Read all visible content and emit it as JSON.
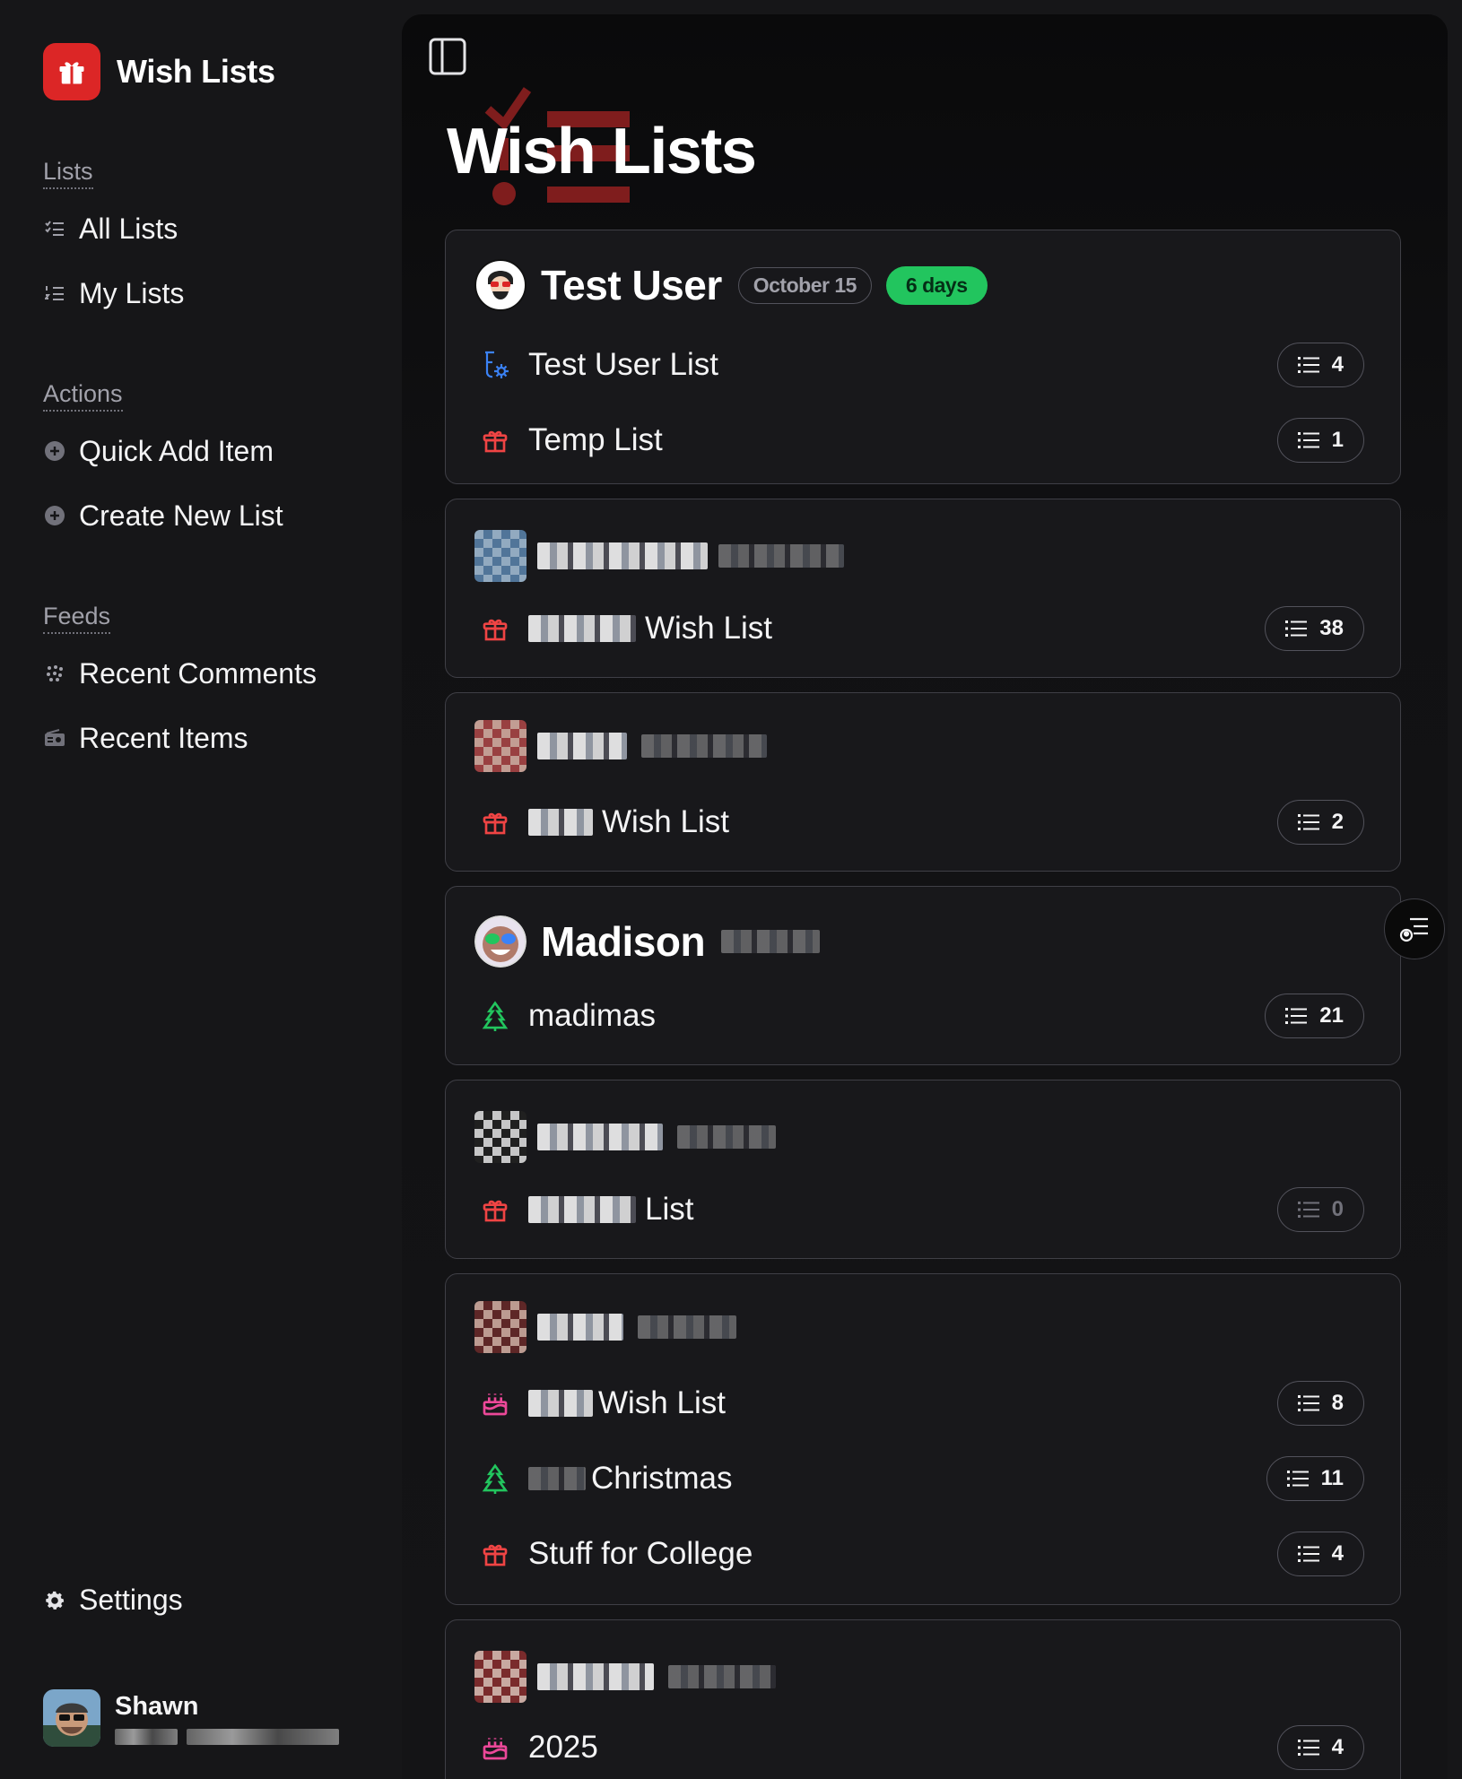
{
  "app": {
    "name": "Wish Lists"
  },
  "sidebar": {
    "sections": [
      {
        "label": "Lists",
        "items": [
          {
            "label": "All Lists",
            "icon": "list-check-icon"
          },
          {
            "label": "My Lists",
            "icon": "list-ordered-icon"
          }
        ]
      },
      {
        "label": "Actions",
        "items": [
          {
            "label": "Quick Add Item",
            "icon": "plus-circle-icon"
          },
          {
            "label": "Create New List",
            "icon": "plus-circle-icon"
          }
        ]
      },
      {
        "label": "Feeds",
        "items": [
          {
            "label": "Recent Comments",
            "icon": "comments-icon"
          },
          {
            "label": "Recent Items",
            "icon": "radio-icon"
          }
        ]
      }
    ],
    "settings_label": "Settings",
    "user": {
      "name": "Shawn"
    }
  },
  "main": {
    "title": "Wish Lists",
    "groups": [
      {
        "owner": "Test User",
        "date": "October 15",
        "days": "6 days",
        "lists": [
          {
            "name": "Test User List",
            "icon": "flask-gear-icon",
            "count": "4"
          },
          {
            "name": "Temp List",
            "icon": "gift-icon",
            "count": "1"
          }
        ]
      },
      {
        "owner": "",
        "lists": [
          {
            "name": "Wish List",
            "icon": "gift-icon",
            "count": "38"
          }
        ]
      },
      {
        "owner": "",
        "lists": [
          {
            "name": "Wish List",
            "icon": "gift-icon",
            "count": "2"
          }
        ]
      },
      {
        "owner": "Madison",
        "lists": [
          {
            "name": "madimas",
            "icon": "tree-icon",
            "count": "21"
          }
        ]
      },
      {
        "owner": "",
        "lists": [
          {
            "name": "List",
            "icon": "gift-icon",
            "count": "0"
          }
        ]
      },
      {
        "owner": "",
        "lists": [
          {
            "name": "Wish List",
            "icon": "cake-icon",
            "count": "8"
          },
          {
            "name": "Christmas",
            "icon": "tree-icon",
            "count": "11"
          },
          {
            "name": "Stuff for College",
            "icon": "gift-icon",
            "count": "4"
          }
        ]
      },
      {
        "owner": "",
        "lists": [
          {
            "name": "2025",
            "icon": "cake-icon",
            "count": "4"
          }
        ]
      }
    ]
  },
  "colors": {
    "brand": "#dc2626",
    "days_badge": "#22c55e",
    "tree": "#22c55e",
    "gift": "#ef4444",
    "cake": "#ec4899"
  }
}
